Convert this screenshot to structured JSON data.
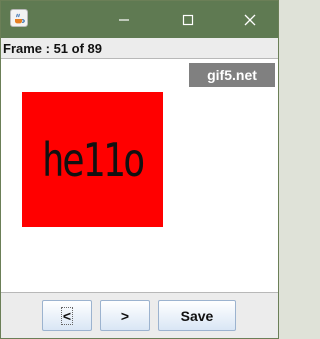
{
  "window": {
    "app_icon": "java-cup-icon",
    "controls": [
      "minimize-icon",
      "maximize-icon",
      "close-icon"
    ]
  },
  "status": {
    "frame_label": "Frame : 51 of 89"
  },
  "preview": {
    "watermark": "gif5.net",
    "frame_text": "he11o",
    "frame_color": "#ff0000",
    "canvas_color": "#ffffff"
  },
  "controls": {
    "prev_label": "<",
    "next_label": ">",
    "save_label": "Save"
  }
}
